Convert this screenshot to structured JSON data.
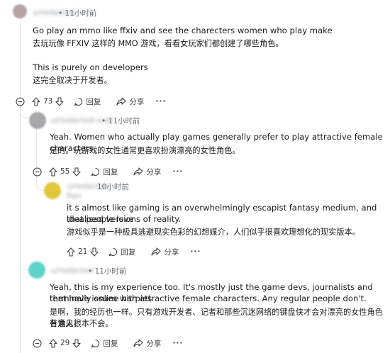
{
  "comments": [
    {
      "time": "11小时前",
      "text_en_1": "Go play an mmo like ffxiv and see the charecters women who play make",
      "text_zh_1": "去玩玩像 FFXIV 这样的 MMO 游戏，看看女玩家们都创建了哪些角色。",
      "text_en_2": "This is purely on developers",
      "text_zh_2": "这完全取决于开发者。",
      "votes": "73",
      "reply_label": "回复",
      "share_label": "分享"
    },
    {
      "time": "11小时前",
      "text_en_1": "Yeah. Women who actually play games generally prefer to play attractive female characters.",
      "text_zh_1": "是的。玩游戏的女性通常更喜欢扮演漂亮的女性角色。",
      "votes": "55",
      "reply_label": "回复",
      "share_label": "分享"
    },
    {
      "time": "10小时前",
      "text_en_1": "it s almost like gaming is an overwhelmingly escapist fantasy medium, and that people love",
      "text_en_2": "idealised versions of reality.",
      "text_zh_1": "游戏似乎是一种极具逃避现实色彩的幻想媒介，人们似乎很喜欢理想化的现实版本。",
      "votes": "21",
      "reply_label": "回复",
      "share_label": "分享"
    },
    {
      "time": "11小时前",
      "text_en_1": "Yeah, this is my experience too. It's mostly just the game devs, journalists and terminally online harpies",
      "text_en_2": "that have issues with attractive female characters. Any regular people don't.",
      "text_zh_1": "是啊，我的经历也一样。只有游戏开发者、记者和那些沉迷网络的键盘侠才会对漂亮的女性角色有意见。",
      "text_zh_2": "普通人根本不会。",
      "votes": "29",
      "reply_label": "回复",
      "share_label": "分享"
    }
  ]
}
